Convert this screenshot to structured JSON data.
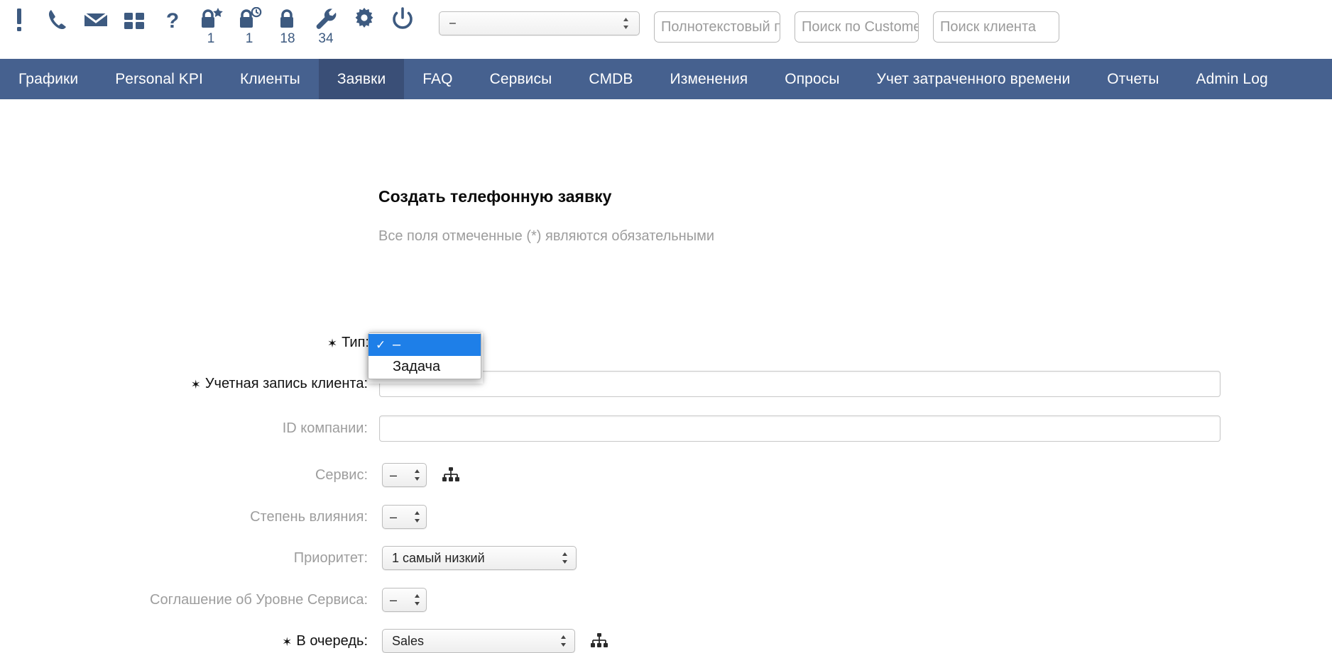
{
  "toolbar": {
    "icons": [
      {
        "name": "alert-exclamation-icon",
        "label": "!",
        "count": null
      },
      {
        "name": "phone-icon",
        "label": "",
        "count": null
      },
      {
        "name": "envelope-icon",
        "label": "",
        "count": null
      },
      {
        "name": "grid-apps-icon",
        "label": "",
        "count": null
      },
      {
        "name": "question-help-icon",
        "label": "?",
        "count": null
      },
      {
        "name": "lock-star-icon",
        "label": "",
        "count": "1"
      },
      {
        "name": "lock-clock-icon",
        "label": "",
        "count": "1"
      },
      {
        "name": "lock-icon",
        "label": "",
        "count": "18"
      },
      {
        "name": "wrench-icon",
        "label": "",
        "count": "34"
      },
      {
        "name": "gear-icon",
        "label": "",
        "count": null
      },
      {
        "name": "power-icon",
        "label": "",
        "count": null
      }
    ],
    "select_value": "–",
    "search_fulltext_placeholder": "Полнотекстовый поиск",
    "search_customer_placeholder": "Поиск по CustomerID",
    "search_client_placeholder": "Поиск клиента"
  },
  "nav": {
    "items": [
      {
        "label": "Графики",
        "active": false
      },
      {
        "label": "Personal KPI",
        "active": false
      },
      {
        "label": "Клиенты",
        "active": false
      },
      {
        "label": "Заявки",
        "active": true
      },
      {
        "label": "FAQ",
        "active": false
      },
      {
        "label": "Сервисы",
        "active": false
      },
      {
        "label": "CMDB",
        "active": false
      },
      {
        "label": "Изменения",
        "active": false
      },
      {
        "label": "Опросы",
        "active": false
      },
      {
        "label": "Учет затраченного времени",
        "active": false
      },
      {
        "label": "Отчеты",
        "active": false
      },
      {
        "label": "Admin Log",
        "active": false
      }
    ]
  },
  "form": {
    "title": "Создать телефонную заявку",
    "note": "Все поля отмеченные (*) являются обязательными",
    "fields": {
      "type_label": "Тип:",
      "customer_user_label": "Учетная запись клиента:",
      "customer_user_value": "",
      "company_id_label": "ID компании:",
      "company_id_value": "",
      "service_label": "Сервис:",
      "service_value": "–",
      "impact_label": "Степень влияния:",
      "impact_value": "–",
      "priority_label": "Приоритет:",
      "priority_value": "1 самый низкий",
      "sla_label": "Соглашение об Уровне Сервиса:",
      "sla_value": "–",
      "queue_label": "В очередь:",
      "queue_value": "Sales"
    },
    "type_dropdown": {
      "open": true,
      "options": [
        {
          "label": "–",
          "selected": true,
          "check": "✓"
        },
        {
          "label": "Задача",
          "selected": false,
          "check": ""
        }
      ]
    }
  },
  "colors": {
    "nav_bg": "#46618f",
    "nav_active_bg": "#3a4f77",
    "icon_blue": "#3d5a80",
    "dropdown_highlight": "#1e7fe8",
    "label_grey": "#9d9d9d"
  }
}
